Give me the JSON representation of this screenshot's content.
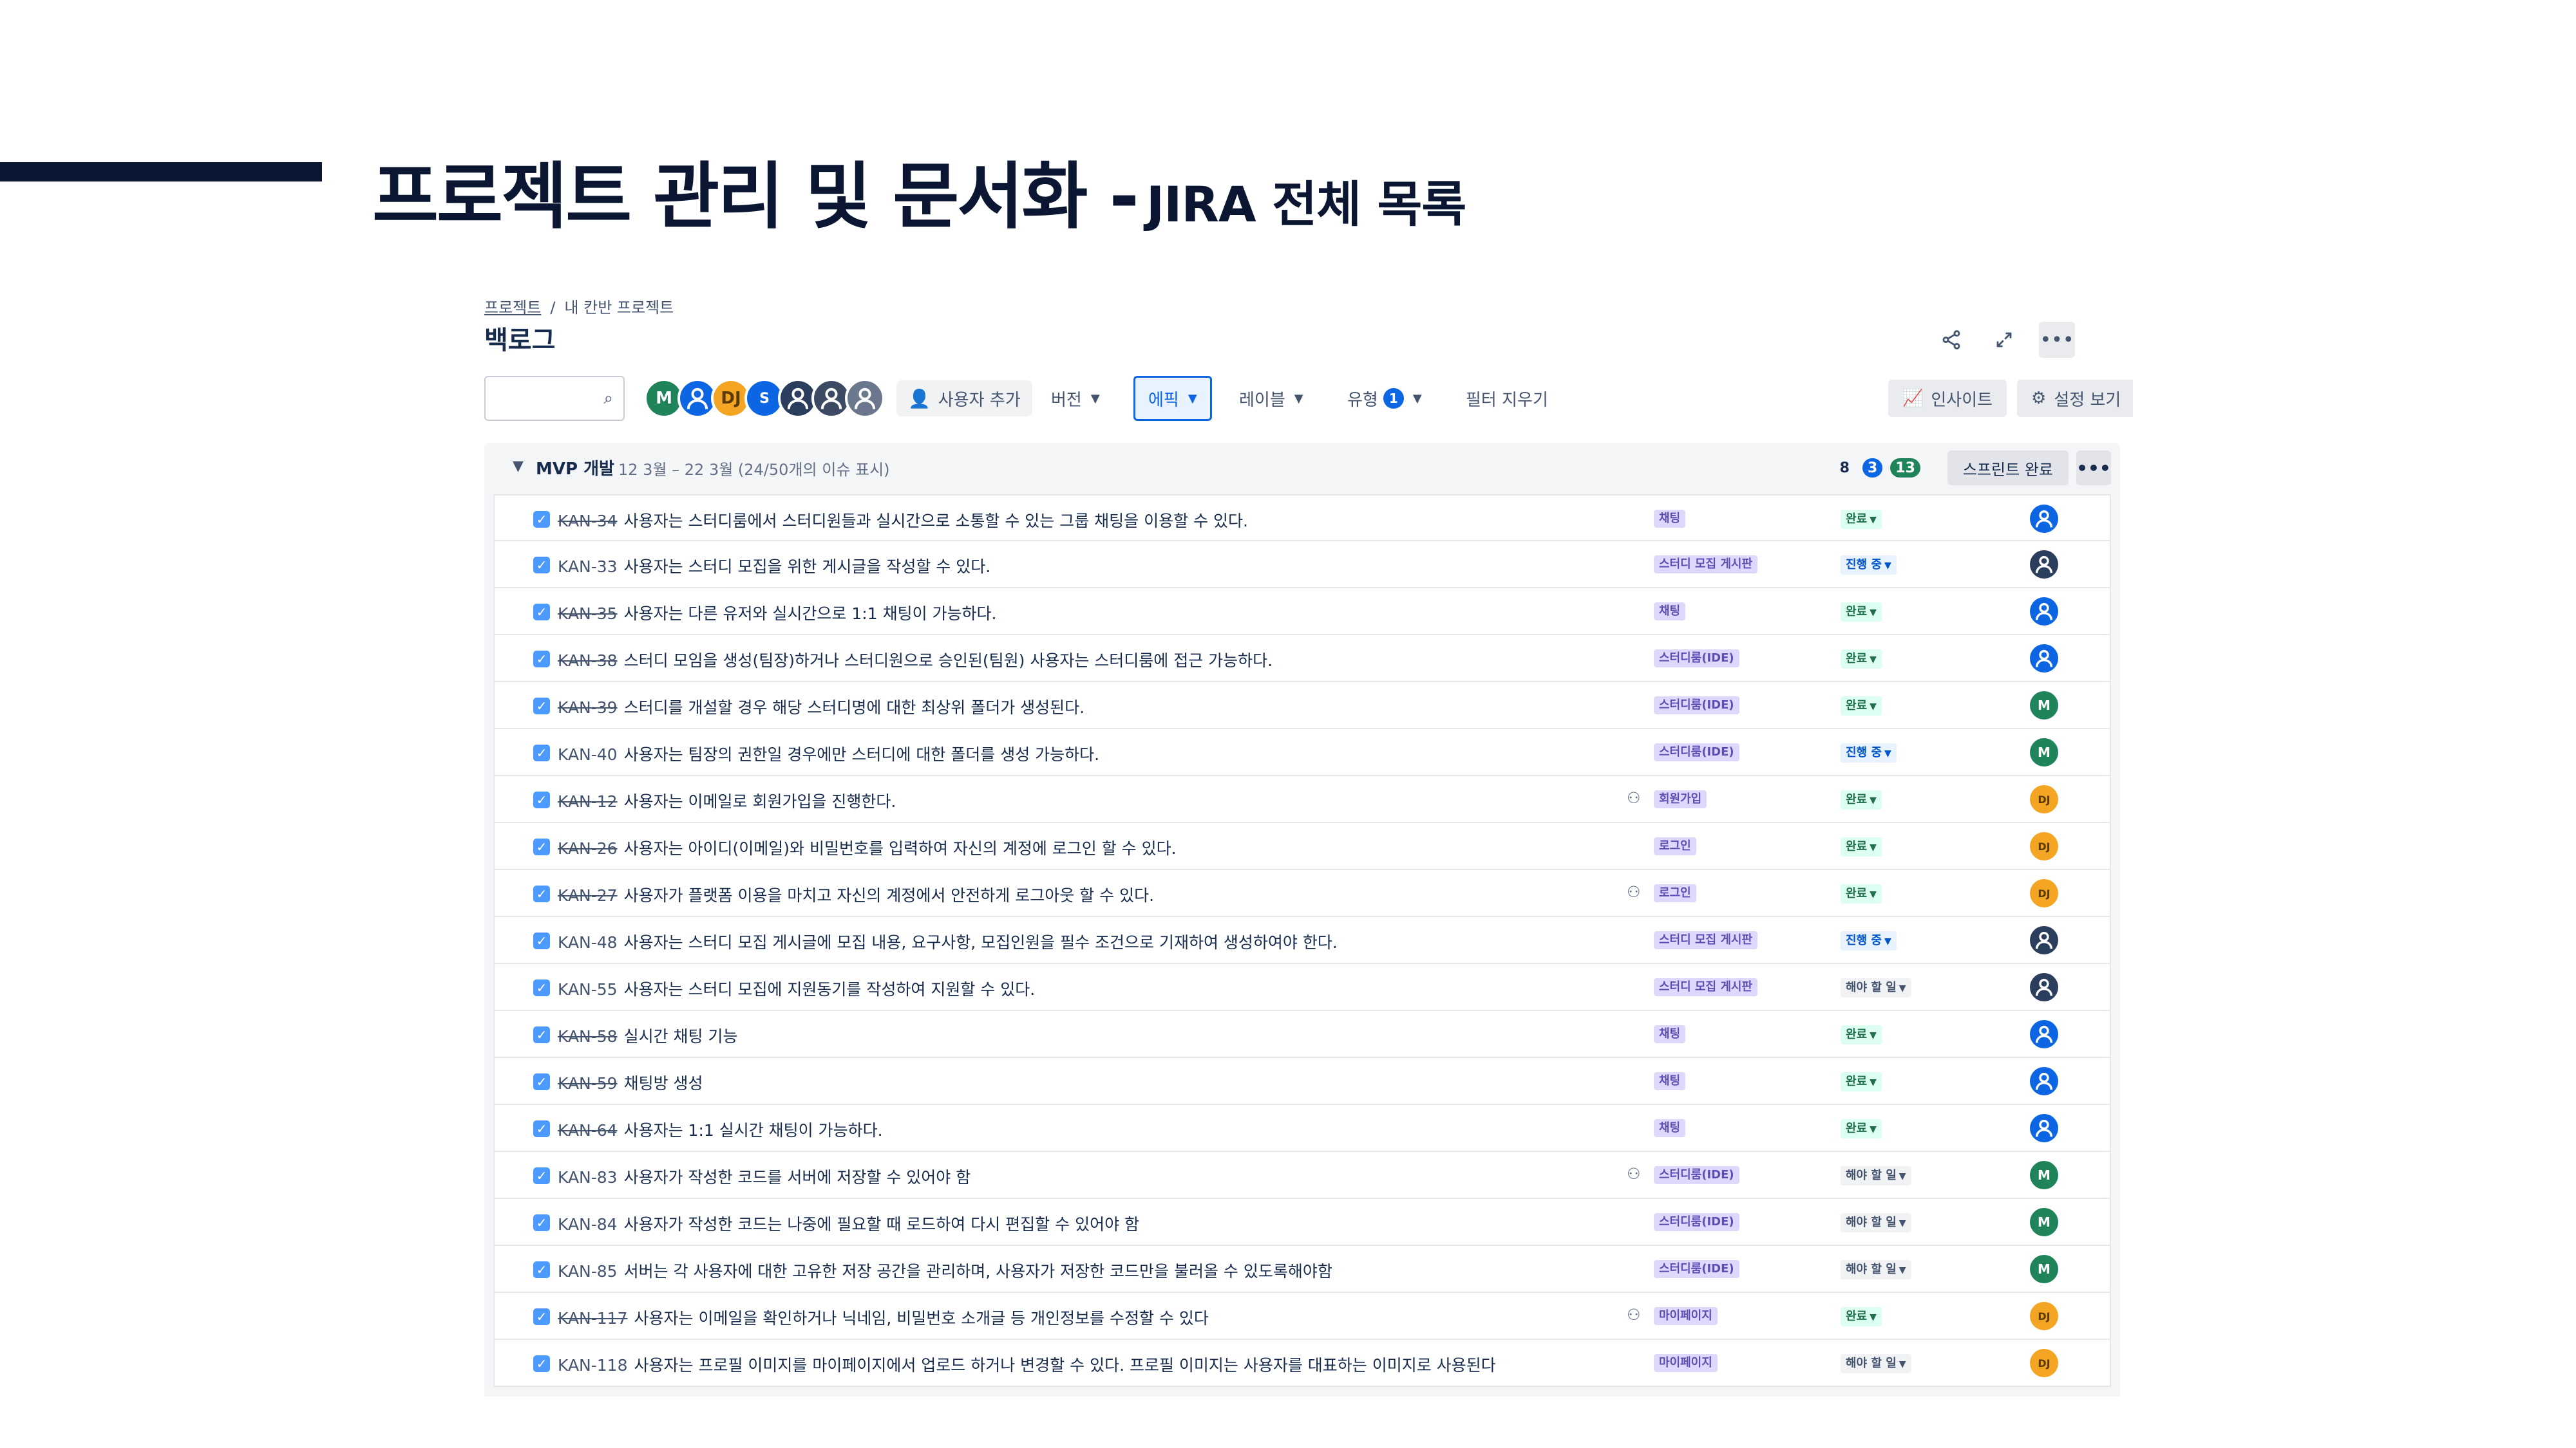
{
  "slide": {
    "title_main": "프로젝트 관리 및 문서화 -",
    "title_sub": "JIRA 전체 목록"
  },
  "breadcrumb": {
    "project": "프로젝트",
    "separator": "/",
    "board": "내 칸반 프로젝트"
  },
  "page_title": "백로그",
  "top_actions": {
    "share_icon": "share-icon",
    "expand_icon": "expand-icon",
    "more_icon": "more-icon"
  },
  "toolbar": {
    "search_placeholder": "",
    "avatars": [
      "M",
      "",
      "DJ",
      "S",
      "",
      "",
      ""
    ],
    "add_user": "사용자 추가",
    "version": "버전",
    "epic": "에픽",
    "label": "레이블",
    "type": "유형",
    "type_count": "1",
    "clear_filters": "필터 지우기",
    "insights": "인사이트",
    "view_settings": "설정 보기"
  },
  "sprint": {
    "name": "MVP 개발",
    "meta": "12 3월 – 22 3월  (24/50개의 이슈 표시)",
    "count_todo": "8",
    "count_progress": "3",
    "count_done": "13",
    "complete_label": "스프린트 완료"
  },
  "colors": {
    "accent_bar": "#0b1633",
    "primary": "#0c66e4",
    "done": "#1f845a",
    "epic_bg": "#dfd8fd"
  },
  "issues": [
    {
      "key": "KAN-34",
      "summary": "사용자는 스터디룸에서 스터디원들과 실시간으로 소통할 수 있는 그룹 채팅을 이용할 수 있다.",
      "epic": "채팅",
      "status": "완료",
      "done": true,
      "child": false,
      "assignee": "person",
      "assignee_color": "blue"
    },
    {
      "key": "KAN-33",
      "summary": "사용자는 스터디 모집을 위한 게시글을 작성할 수 있다.",
      "epic": "스터디 모집 게시판",
      "status": "진행 중",
      "done": false,
      "child": false,
      "assignee": "person",
      "assignee_color": "dark"
    },
    {
      "key": "KAN-35",
      "summary": "사용자는 다른 유저와 실시간으로 1:1 채팅이 가능하다.",
      "epic": "채팅",
      "status": "완료",
      "done": true,
      "child": false,
      "assignee": "person",
      "assignee_color": "blue"
    },
    {
      "key": "KAN-38",
      "summary": "스터디 모임을 생성(팀장)하거나 스터디원으로 승인된(팀원) 사용자는 스터디룸에 접근 가능하다.",
      "epic": "스터디룸(IDE)",
      "status": "완료",
      "done": true,
      "child": false,
      "assignee": "person",
      "assignee_color": "blue"
    },
    {
      "key": "KAN-39",
      "summary": "스터디를 개설할 경우 해당 스터디명에 대한 최상위 폴더가 생성된다.",
      "epic": "스터디룸(IDE)",
      "status": "완료",
      "done": true,
      "child": false,
      "assignee": "M",
      "assignee_color": "green"
    },
    {
      "key": "KAN-40",
      "summary": "사용자는 팀장의 권한일 경우에만 스터디에 대한 폴더를 생성 가능하다.",
      "epic": "스터디룸(IDE)",
      "status": "진행 중",
      "done": false,
      "child": false,
      "assignee": "M",
      "assignee_color": "green"
    },
    {
      "key": "KAN-12",
      "summary": "사용자는 이메일로 회원가입을 진행한다.",
      "epic": "회원가입",
      "status": "완료",
      "done": true,
      "child": true,
      "assignee": "DJ",
      "assignee_color": "orange"
    },
    {
      "key": "KAN-26",
      "summary": "사용자는 아이디(이메일)와 비밀번호를 입력하여 자신의 계정에 로그인 할 수 있다.",
      "epic": "로그인",
      "status": "완료",
      "done": true,
      "child": false,
      "assignee": "DJ",
      "assignee_color": "orange"
    },
    {
      "key": "KAN-27",
      "summary": "사용자가 플랫폼 이용을 마치고 자신의 계정에서 안전하게 로그아웃 할 수 있다.",
      "epic": "로그인",
      "status": "완료",
      "done": true,
      "child": true,
      "assignee": "DJ",
      "assignee_color": "orange"
    },
    {
      "key": "KAN-48",
      "summary": "사용자는 스터디 모집 게시글에 모집 내용, 요구사항, 모집인원을 필수 조건으로 기재하여 생성하여야 한다.",
      "epic": "스터디 모집 게시판",
      "status": "진행 중",
      "done": false,
      "child": false,
      "assignee": "person",
      "assignee_color": "dark"
    },
    {
      "key": "KAN-55",
      "summary": "사용자는 스터디 모집에 지원동기를 작성하여 지원할 수 있다.",
      "epic": "스터디 모집 게시판",
      "status": "해야 할 일",
      "done": false,
      "child": false,
      "assignee": "person",
      "assignee_color": "dark"
    },
    {
      "key": "KAN-58",
      "summary": "실시간 채팅 기능",
      "epic": "채팅",
      "status": "완료",
      "done": true,
      "child": false,
      "assignee": "person",
      "assignee_color": "blue"
    },
    {
      "key": "KAN-59",
      "summary": "채팅방 생성",
      "epic": "채팅",
      "status": "완료",
      "done": true,
      "child": false,
      "assignee": "person",
      "assignee_color": "blue"
    },
    {
      "key": "KAN-64",
      "summary": "사용자는 1:1 실시간 채팅이 가능하다.",
      "epic": "채팅",
      "status": "완료",
      "done": true,
      "child": false,
      "assignee": "person",
      "assignee_color": "blue"
    },
    {
      "key": "KAN-83",
      "summary": "사용자가 작성한 코드를 서버에 저장할 수 있어야 함",
      "epic": "스터디룸(IDE)",
      "status": "해야 할 일",
      "done": false,
      "child": true,
      "assignee": "M",
      "assignee_color": "green"
    },
    {
      "key": "KAN-84",
      "summary": "사용자가 작성한 코드는 나중에 필요할 때 로드하여 다시 편집할 수 있어야 함",
      "epic": "스터디룸(IDE)",
      "status": "해야 할 일",
      "done": false,
      "child": false,
      "assignee": "M",
      "assignee_color": "green"
    },
    {
      "key": "KAN-85",
      "summary": "서버는 각 사용자에 대한 고유한 저장 공간을 관리하며, 사용자가 저장한 코드만을 불러올 수 있도록해야함",
      "epic": "스터디룸(IDE)",
      "status": "해야 할 일",
      "done": false,
      "child": false,
      "assignee": "M",
      "assignee_color": "green"
    },
    {
      "key": "KAN-117",
      "summary": "사용자는 이메일을 확인하거나 닉네임, 비밀번호 소개글 등 개인정보를 수정할 수 있다",
      "epic": "마이페이지",
      "status": "완료",
      "done": true,
      "child": true,
      "assignee": "DJ",
      "assignee_color": "orange"
    },
    {
      "key": "KAN-118",
      "summary": "사용자는 프로필 이미지를 마이페이지에서 업로드 하거나 변경할 수 있다. 프로필 이미지는 사용자를 대표하는 이미지로 사용된다",
      "epic": "마이페이지",
      "status": "해야 할 일",
      "done": false,
      "child": false,
      "assignee": "DJ",
      "assignee_color": "orange"
    }
  ]
}
